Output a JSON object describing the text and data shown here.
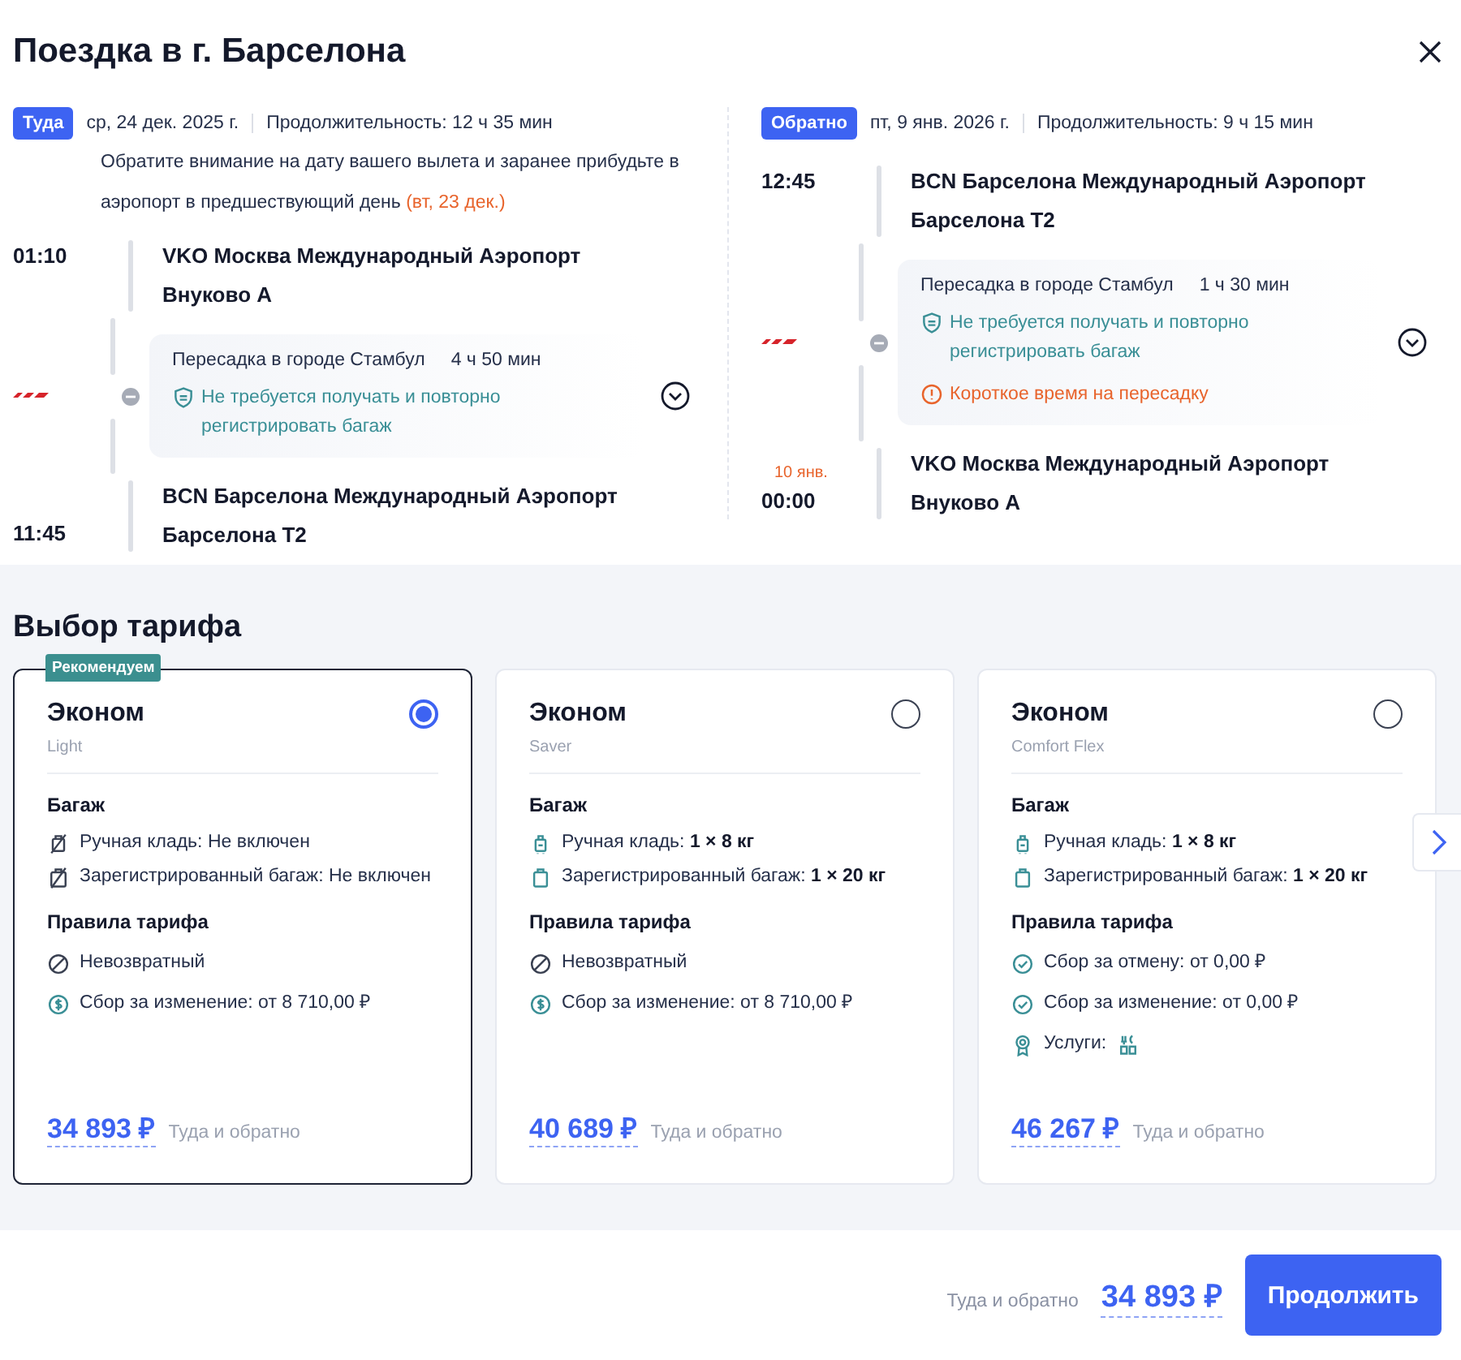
{
  "title": "Поездка в г. Барселона",
  "legs": [
    {
      "badge": "Туда",
      "date": "ср, 24 дек. 2025 г.",
      "duration": "Продолжительность: 12 ч 35 мин",
      "note": "Обратите внимание на дату вашего вылета и заранее прибудьте в аэропорт в предшествующий день",
      "note_highlight": "(вт, 23 дек.)",
      "departure": {
        "time": "01:10",
        "airport": "VKO Москва Международный Аэропорт Внуково A"
      },
      "transfer": {
        "city": "Пересадка в городе Стамбул",
        "duration": "4 ч 50 мин",
        "notices": [
          {
            "kind": "baggage",
            "text": "Не требуется получать и повторно регистрировать багаж"
          }
        ]
      },
      "arrival": {
        "time": "11:45",
        "airport": "BCN Барселона Международный Аэропорт Барселона T2"
      }
    },
    {
      "badge": "Обратно",
      "date": "пт, 9 янв. 2026 г.",
      "duration": "Продолжительность: 9 ч 15 мин",
      "departure": {
        "time": "12:45",
        "airport": "BCN Барселона Международный Аэропорт Барселона T2"
      },
      "transfer": {
        "city": "Пересадка в городе Стамбул",
        "duration": "1 ч 30 мин",
        "notices": [
          {
            "kind": "baggage",
            "text": "Не требуется получать и повторно регистрировать багаж"
          },
          {
            "kind": "warning",
            "text": "Короткое время на пересадку"
          }
        ]
      },
      "arrival": {
        "time": "00:00",
        "date_shift": "10 янв.",
        "airport": "VKO Москва Международный Аэропорт Внуково A"
      }
    }
  ],
  "fares_title": "Выбор тарифа",
  "fares": [
    {
      "badge": "Рекомендуем",
      "name": "Эконом",
      "subtitle": "Light",
      "selected": true,
      "baggage_title": "Багаж",
      "baggage": [
        {
          "kind": "cabin-excluded",
          "text": "Ручная кладь: Не включен"
        },
        {
          "kind": "checked-excluded",
          "text": "Зарегистрированный багаж: Не включен"
        }
      ],
      "rules_title": "Правила тарифа",
      "rules": [
        {
          "kind": "nonrefundable",
          "text": "Невозвратный"
        },
        {
          "kind": "fee",
          "text": "Сбор за изменение: от 8 710,00 ₽"
        }
      ],
      "price": "34 893 ₽",
      "price_note": "Туда и обратно"
    },
    {
      "name": "Эконом",
      "subtitle": "Saver",
      "selected": false,
      "baggage_title": "Багаж",
      "baggage": [
        {
          "kind": "cabin",
          "text": "Ручная кладь: **1 × 8 кг**"
        },
        {
          "kind": "checked",
          "text": "Зарегистрированный багаж: **1 × 20 кг**"
        }
      ],
      "rules_title": "Правила тарифа",
      "rules": [
        {
          "kind": "nonrefundable",
          "text": "Невозвратный"
        },
        {
          "kind": "fee",
          "text": "Сбор за изменение: от 8 710,00 ₽"
        }
      ],
      "price": "40 689 ₽",
      "price_note": "Туда и обратно"
    },
    {
      "name": "Эконом",
      "subtitle": "Comfort Flex",
      "selected": false,
      "baggage_title": "Багаж",
      "baggage": [
        {
          "kind": "cabin",
          "text": "Ручная кладь: **1 × 8 кг**"
        },
        {
          "kind": "checked",
          "text": "Зарегистрированный багаж: **1 × 20 кг**"
        }
      ],
      "rules_title": "Правила тарифа",
      "rules": [
        {
          "kind": "free",
          "text": "Сбор за отмену: от 0,00 ₽"
        },
        {
          "kind": "free",
          "text": "Сбор за изменение: от 0,00 ₽"
        },
        {
          "kind": "services",
          "text": "Услуги:"
        }
      ],
      "price": "46 267 ₽",
      "price_note": "Туда и обратно"
    }
  ],
  "footer": {
    "price_note": "Туда и обратно",
    "price": "34 893 ₽",
    "button": "Продолжить"
  }
}
